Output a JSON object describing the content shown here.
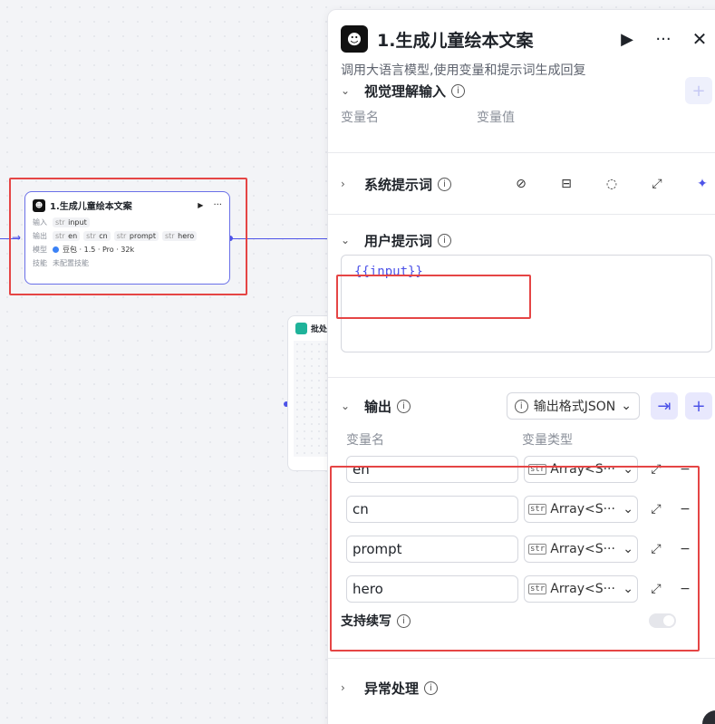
{
  "node": {
    "title": "1.生成儿童绘本文案",
    "run_icon": "▶",
    "more_icon": "···",
    "input_label": "输入",
    "input_chip": "input",
    "output_label": "输出",
    "outputs": [
      "en",
      "cn",
      "prompt",
      "hero"
    ],
    "model_label": "模型",
    "model_value": "豆包 · 1.5 · Pro · 32k",
    "skill_label": "技能",
    "skill_value": "未配置技能",
    "str_tag": "str"
  },
  "node2": {
    "title": "批处"
  },
  "panel": {
    "title": "1.生成儿童绘本文案",
    "description": "调用大语言模型,使用变量和提示词生成回复",
    "vision": {
      "title": "视觉理解输入",
      "col_name": "变量名",
      "col_value": "变量值"
    },
    "system": {
      "title": "系统提示词"
    },
    "user": {
      "title": "用户提示词",
      "content": "{{input}}"
    },
    "output": {
      "title": "输出",
      "format_label": "输出格式JSON",
      "col_name": "变量名",
      "col_type": "变量类型",
      "rows": [
        {
          "name": "en",
          "type": "Array<S···"
        },
        {
          "name": "cn",
          "type": "Array<S···"
        },
        {
          "name": "prompt",
          "type": "Array<S···"
        },
        {
          "name": "hero",
          "type": "Array<S···"
        }
      ],
      "str_tag": "str",
      "continue_label": "支持续写"
    },
    "exception": {
      "title": "异常处理"
    }
  },
  "colors": {
    "accent": "#4d53e8",
    "highlight": "#e54545"
  }
}
